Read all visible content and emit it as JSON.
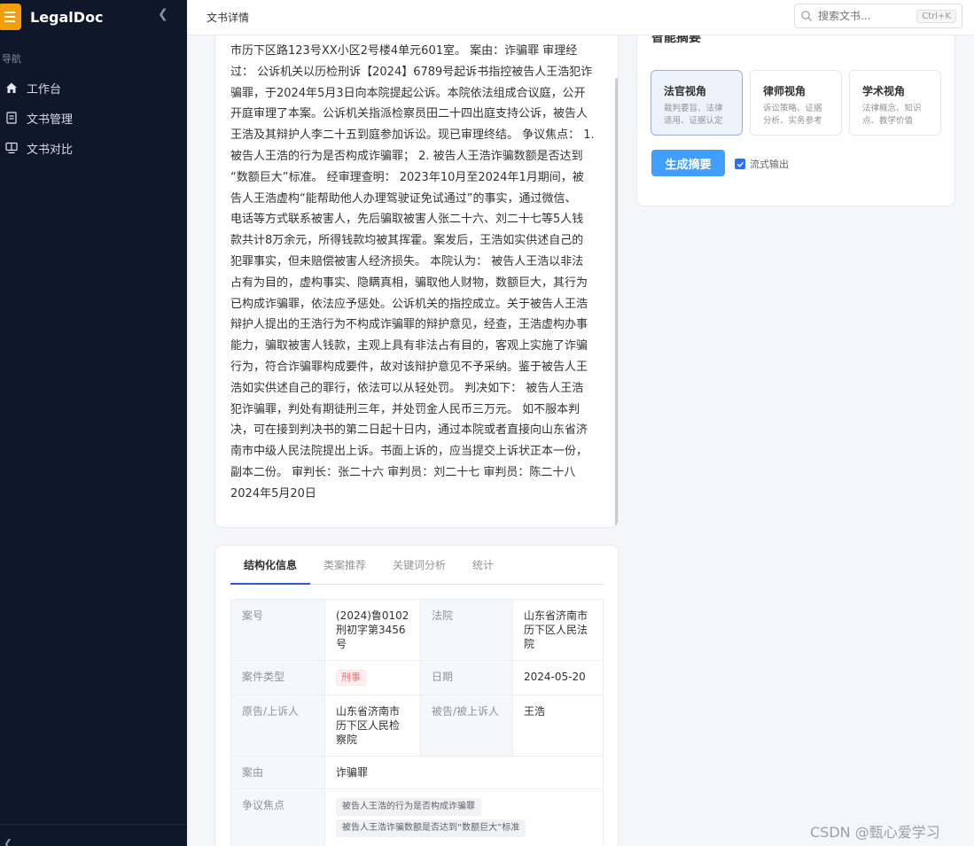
{
  "app": {
    "brand": "LegalDoc",
    "nav_title": "导航",
    "nav": [
      {
        "label": "工作台",
        "icon": "home-icon"
      },
      {
        "label": "文书管理",
        "icon": "document-icon"
      },
      {
        "label": "文书对比",
        "icon": "compare-icon"
      }
    ]
  },
  "topbar": {
    "title": "文书详情",
    "search_placeholder": "搜索文书...",
    "shortcut": "Ctrl+K"
  },
  "document": {
    "lines": [
      "市历下区路123号XX小区2号楼4单元601室。 案由：诈骗罪 审理经",
      "过： 公诉机关以历检刑诉【2024】6789号起诉书指控被告人王浩犯诈",
      "骗罪，于2024年5月3日向本院提起公诉。本院依法组成合议庭，公开",
      "开庭审理了本案。公诉机关指派检察员田二十四出庭支持公诉，被告人",
      "王浩及其辩护人李二十五到庭参加诉讼。现已审理终结。 争议焦点： 1.",
      "被告人王浩的行为是否构成诈骗罪； 2. 被告人王浩诈骗数额是否达到",
      "“数额巨大”标准。 经审理查明： 2023年10月至2024年1月期间，被",
      "告人王浩虚构“能帮助他人办理驾驶证免试通过”的事实，通过微信、",
      "电话等方式联系被害人，先后骗取被害人张二十六、刘二十七等5人钱",
      "款共计8万余元，所得钱款均被其挥霍。案发后，王浩如实供述自己的",
      "犯罪事实，但未赔偿被害人经济损失。 本院认为： 被告人王浩以非法",
      "占有为目的，虚构事实、隐瞒真相，骗取他人财物，数额巨大，其行为",
      "已构成诈骗罪，依法应予惩处。公诉机关的指控成立。关于被告人王浩",
      "辩护人提出的王浩行为不构成诈骗罪的辩护意见，经查，王浩虚构办事",
      "能力，骗取被害人钱款，主观上具有非法占有目的，客观上实施了诈骗",
      "行为，符合诈骗罪构成要件，故对该辩护意见不予采纳。鉴于被告人王",
      "浩如实供述自己的罪行，依法可以从轻处罚。 判决如下： 被告人王浩",
      "犯诈骗罪，判处有期徒刑三年，并处罚金人民币三万元。 如不服本判",
      "决，可在接到判决书的第二日起十日内，通过本院或者直接向山东省济",
      "南市中级人民法院提出上诉。书面上诉的，应当提交上诉状正本一份，",
      "副本二份。 审判长：张二十六 审判员：刘二十七 审判员：陈二十八",
      "2024年5月20日"
    ]
  },
  "info": {
    "tabs": [
      "结构化信息",
      "类案推荐",
      "关键词分析",
      "统计"
    ],
    "case_no_label": "案号",
    "case_no": "(2024)鲁0102刑初字第3456号",
    "court_label": "法院",
    "court": "山东省济南市历下区人民法院",
    "case_type_label": "案件类型",
    "case_type": "刑事",
    "date_label": "日期",
    "date": "2024-05-20",
    "plaintiff_label": "原告/上诉人",
    "plaintiff": "山东省济南市历下区人民检察院",
    "defendant_label": "被告/被上诉人",
    "defendant": "王浩",
    "cause_label": "案由",
    "cause": "诈骗罪",
    "issues_label": "争议焦点",
    "issues": [
      "被告人王浩的行为是否构成诈骗罪",
      "被告人王浩诈骗数额是否达到“数额巨大”标准"
    ]
  },
  "summary": {
    "title": "智能摘要",
    "perspectives": [
      {
        "title": "法官视角",
        "desc": "裁判要旨、法律适用、证据认定"
      },
      {
        "title": "律师视角",
        "desc": "诉讼策略、证据分析、实务参考"
      },
      {
        "title": "学术视角",
        "desc": "法律概念、知识点、教学价值"
      }
    ],
    "generate_label": "生成摘要",
    "stream_label": "流式输出"
  },
  "watermark": "CSDN @甄心爱学习",
  "colors": {
    "sidebar": "#0f172a",
    "accent": "#409eff",
    "brand_logo": "#f59e0b"
  }
}
